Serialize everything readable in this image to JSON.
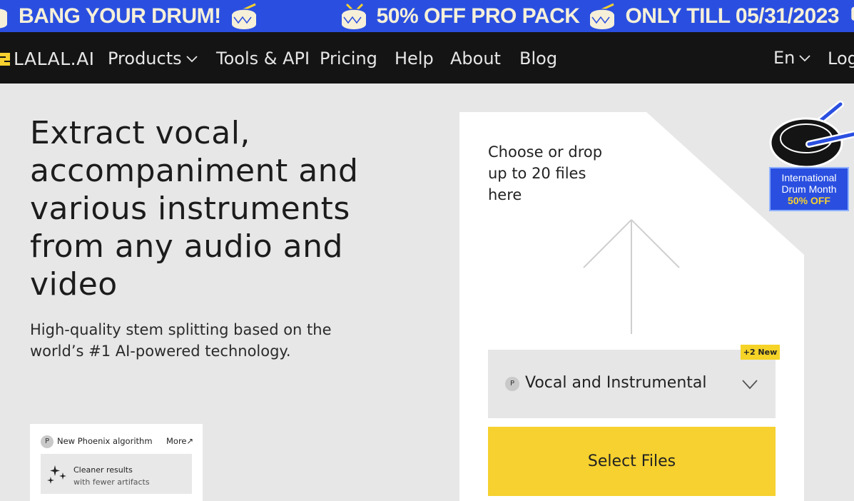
{
  "promo": {
    "text1": "BANG YOUR DRUM!",
    "text2": "50% OFF PRO PACK",
    "text3": "ONLY TILL 05/31/2023"
  },
  "nav": {
    "logo": "LALAL.AI",
    "items": [
      "Products",
      "Tools & API",
      "Pricing",
      "Help",
      "About",
      "Blog"
    ],
    "language": "En",
    "login": "Log"
  },
  "hero": {
    "title": "Extract vocal, accompaniment and various instruments from any audio and video",
    "subtitle": "High-quality stem splitting based on the world’s #1 AI-powered technology."
  },
  "phoenix": {
    "badge": "P",
    "title": "New Phoenix algorithm",
    "more": "More↗",
    "line1": "Cleaner results",
    "line2": "with fewer artifacts"
  },
  "upload": {
    "drop_text": "Choose or drop up to 20 files here",
    "new_tag": "+2 New",
    "model_badge": "P",
    "model": "Vocal and Instrumental",
    "select_button": "Select Files"
  },
  "sticker": {
    "line1": "International",
    "line2": "Drum Month",
    "line3": "50% OFF"
  },
  "colors": {
    "banner": "#2a4fe0",
    "nav": "#141414",
    "accent_yellow": "#f6d12f",
    "background": "#e7e7e7"
  }
}
